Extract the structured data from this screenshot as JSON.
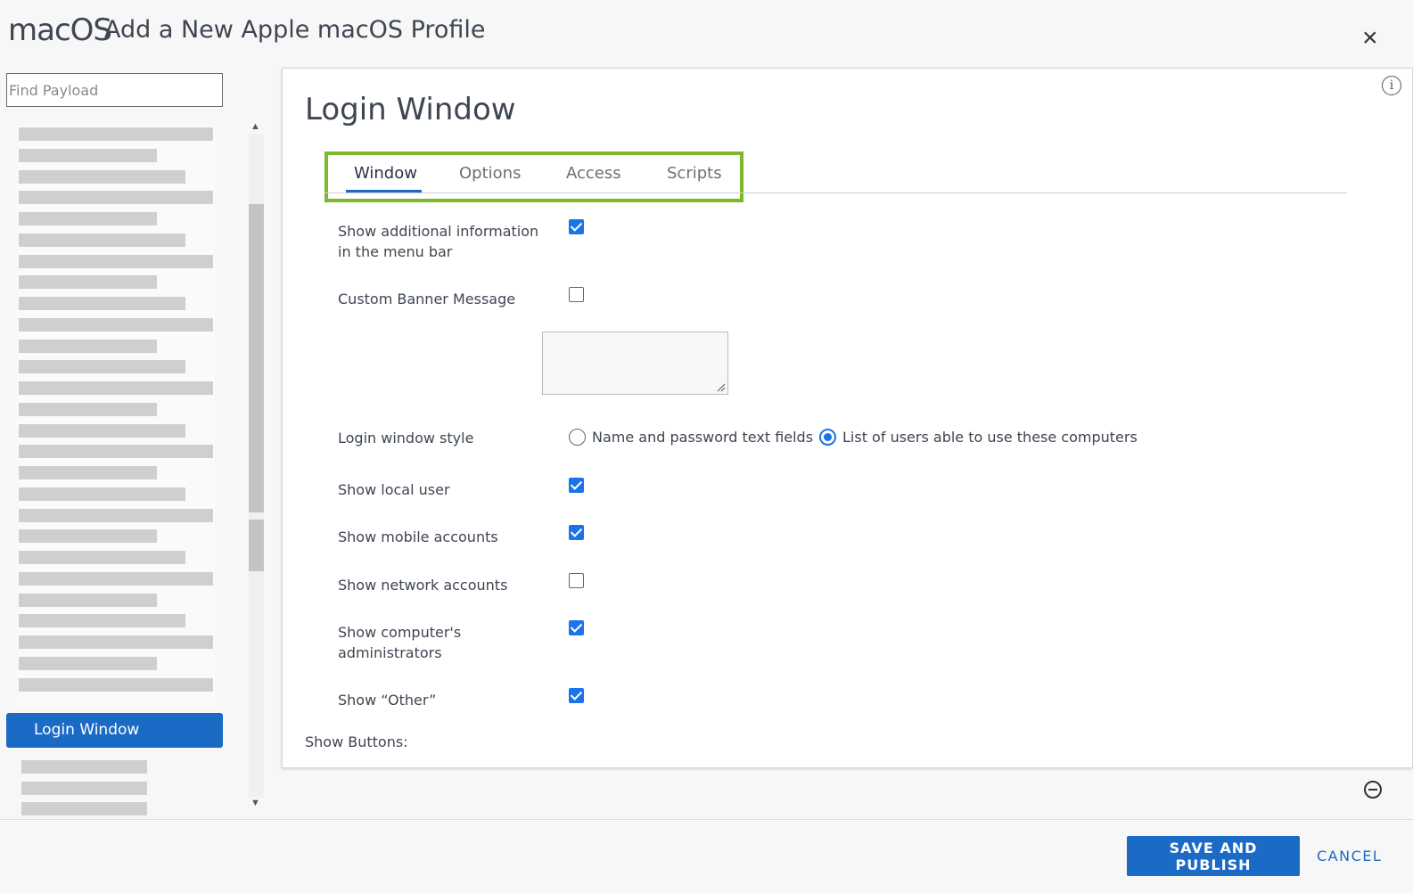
{
  "header": {
    "brand": "macOS",
    "title": "Add a New Apple macOS Profile",
    "close_icon": "×"
  },
  "sidebar": {
    "search_placeholder": "Find Payload",
    "selected_item": "Login Window"
  },
  "panel": {
    "title": "Login Window",
    "info_icon": "i",
    "tabs": [
      "Window",
      "Options",
      "Access",
      "Scripts"
    ],
    "active_tab": "Window",
    "fields": {
      "show_additional_info": {
        "label": "Show additional information in the menu bar",
        "checked": true
      },
      "custom_banner": {
        "label": "Custom Banner Message",
        "checked": false
      },
      "login_style": {
        "label": "Login window style",
        "options": [
          "Name and password text fields",
          "List of users able to use these computers"
        ],
        "selected": "List of users able to use these computers"
      },
      "show_local_user": {
        "label": "Show local user",
        "checked": true
      },
      "show_mobile_accounts": {
        "label": "Show mobile accounts",
        "checked": true
      },
      "show_network_accounts": {
        "label": "Show network accounts",
        "checked": false
      },
      "show_admins": {
        "label": "Show computer's administrators",
        "checked": true
      },
      "show_other": {
        "label": "Show “Other”",
        "checked": true
      }
    },
    "show_buttons_label": "Show Buttons:"
  },
  "footer": {
    "save_label": "SAVE AND PUBLISH",
    "cancel_label": "CANCEL"
  },
  "colors": {
    "accent": "#1b6bc6",
    "checkbox": "#1a73e8",
    "highlight": "#7cb928"
  }
}
